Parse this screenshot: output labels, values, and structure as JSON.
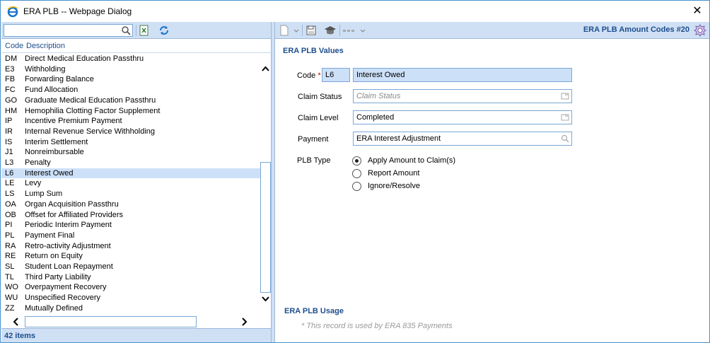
{
  "window": {
    "title": "ERA PLB -- Webpage Dialog"
  },
  "left": {
    "search": {
      "value": "",
      "placeholder": ""
    },
    "columns": {
      "code": "Code",
      "description": "Description"
    },
    "rows": [
      {
        "code": "DM",
        "desc": "Direct Medical Education Passthru"
      },
      {
        "code": "E3",
        "desc": "Withholding"
      },
      {
        "code": "FB",
        "desc": "Forwarding Balance"
      },
      {
        "code": "FC",
        "desc": "Fund Allocation"
      },
      {
        "code": "GO",
        "desc": "Graduate Medical Education Passthru"
      },
      {
        "code": "HM",
        "desc": "Hemophilia Clotting Factor Supplement"
      },
      {
        "code": "IP",
        "desc": "Incentive Premium Payment"
      },
      {
        "code": "IR",
        "desc": "Internal Revenue Service Withholding"
      },
      {
        "code": "IS",
        "desc": "Interim Settlement"
      },
      {
        "code": "J1",
        "desc": "Nonreimbursable"
      },
      {
        "code": "L3",
        "desc": "Penalty"
      },
      {
        "code": "L6",
        "desc": "Interest Owed"
      },
      {
        "code": "LE",
        "desc": "Levy"
      },
      {
        "code": "LS",
        "desc": "Lump Sum"
      },
      {
        "code": "OA",
        "desc": "Organ Acquisition Passthru"
      },
      {
        "code": "OB",
        "desc": "Offset for Affiliated Providers"
      },
      {
        "code": "PI",
        "desc": "Periodic Interim Payment"
      },
      {
        "code": "PL",
        "desc": "Payment Final"
      },
      {
        "code": "RA",
        "desc": "Retro-activity Adjustment"
      },
      {
        "code": "RE",
        "desc": "Return on Equity"
      },
      {
        "code": "SL",
        "desc": "Student Loan Repayment"
      },
      {
        "code": "TL",
        "desc": "Third Party Liability"
      },
      {
        "code": "WO",
        "desc": "Overpayment Recovery"
      },
      {
        "code": "WU",
        "desc": "Unspecified Recovery"
      },
      {
        "code": "ZZ",
        "desc": "Mutually Defined"
      }
    ],
    "selected_code": "L6",
    "status": "42 items"
  },
  "right": {
    "header_title": "ERA PLB Amount Codes #20",
    "values_section": "ERA PLB Values",
    "fields": {
      "code_label": "Code",
      "code_required": "*",
      "code_value": "L6",
      "code_desc": "Interest Owed",
      "claim_status_label": "Claim Status",
      "claim_status_placeholder": "Claim Status",
      "claim_level_label": "Claim Level",
      "claim_level_value": "Completed",
      "payment_label": "Payment",
      "payment_value": "ERA Interest Adjustment",
      "plb_type_label": "PLB Type"
    },
    "plb_type_options": [
      {
        "label": "Apply Amount to Claim(s)",
        "selected": true
      },
      {
        "label": "Report Amount",
        "selected": false
      },
      {
        "label": "Ignore/Resolve",
        "selected": false
      }
    ],
    "usage_section": "ERA PLB Usage",
    "usage_note": "* This record is used by ERA 835 Payments"
  },
  "colors": {
    "accent": "#1e4e8c",
    "toolbar_bg": "#cfe0f5",
    "selection": "#cce0f8"
  }
}
